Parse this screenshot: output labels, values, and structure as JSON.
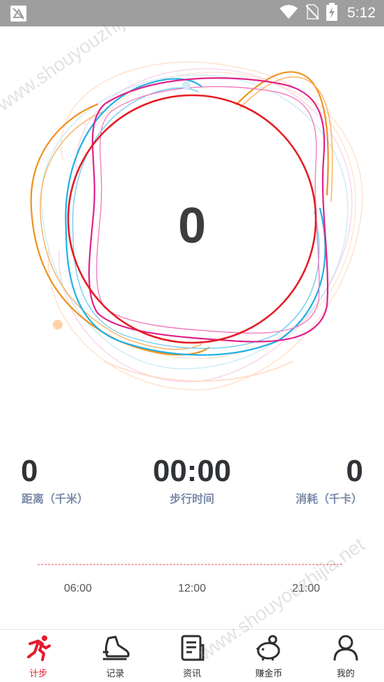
{
  "status_bar": {
    "time": "5:12",
    "icons": [
      "app-notification-icon",
      "wifi-icon",
      "no-sim-icon",
      "battery-charging-icon"
    ]
  },
  "counter": {
    "steps": "0"
  },
  "stats": {
    "distance": {
      "value": "0",
      "label": "距离（千米）"
    },
    "duration": {
      "value": "00:00",
      "label": "步行时间"
    },
    "calories": {
      "value": "0",
      "label": "消耗（千卡）"
    }
  },
  "timeline": {
    "ticks": [
      "06:00",
      "12:00",
      "21:00"
    ]
  },
  "nav": {
    "items": [
      {
        "label": "计步",
        "icon": "running-icon",
        "active": true
      },
      {
        "label": "记录",
        "icon": "shoe-icon",
        "active": false
      },
      {
        "label": "资讯",
        "icon": "news-icon",
        "active": false
      },
      {
        "label": "赚金币",
        "icon": "piggy-bank-icon",
        "active": false
      },
      {
        "label": "我的",
        "icon": "profile-icon",
        "active": false
      }
    ]
  },
  "colors": {
    "accent": "#e8192c",
    "ring_pink": "#e0208a",
    "ring_blue": "#1fb0e6",
    "ring_orange": "#f0901e",
    "stat_label": "#7a8aa8"
  },
  "watermark": {
    "text": "www.shouyouzhijia.net"
  }
}
